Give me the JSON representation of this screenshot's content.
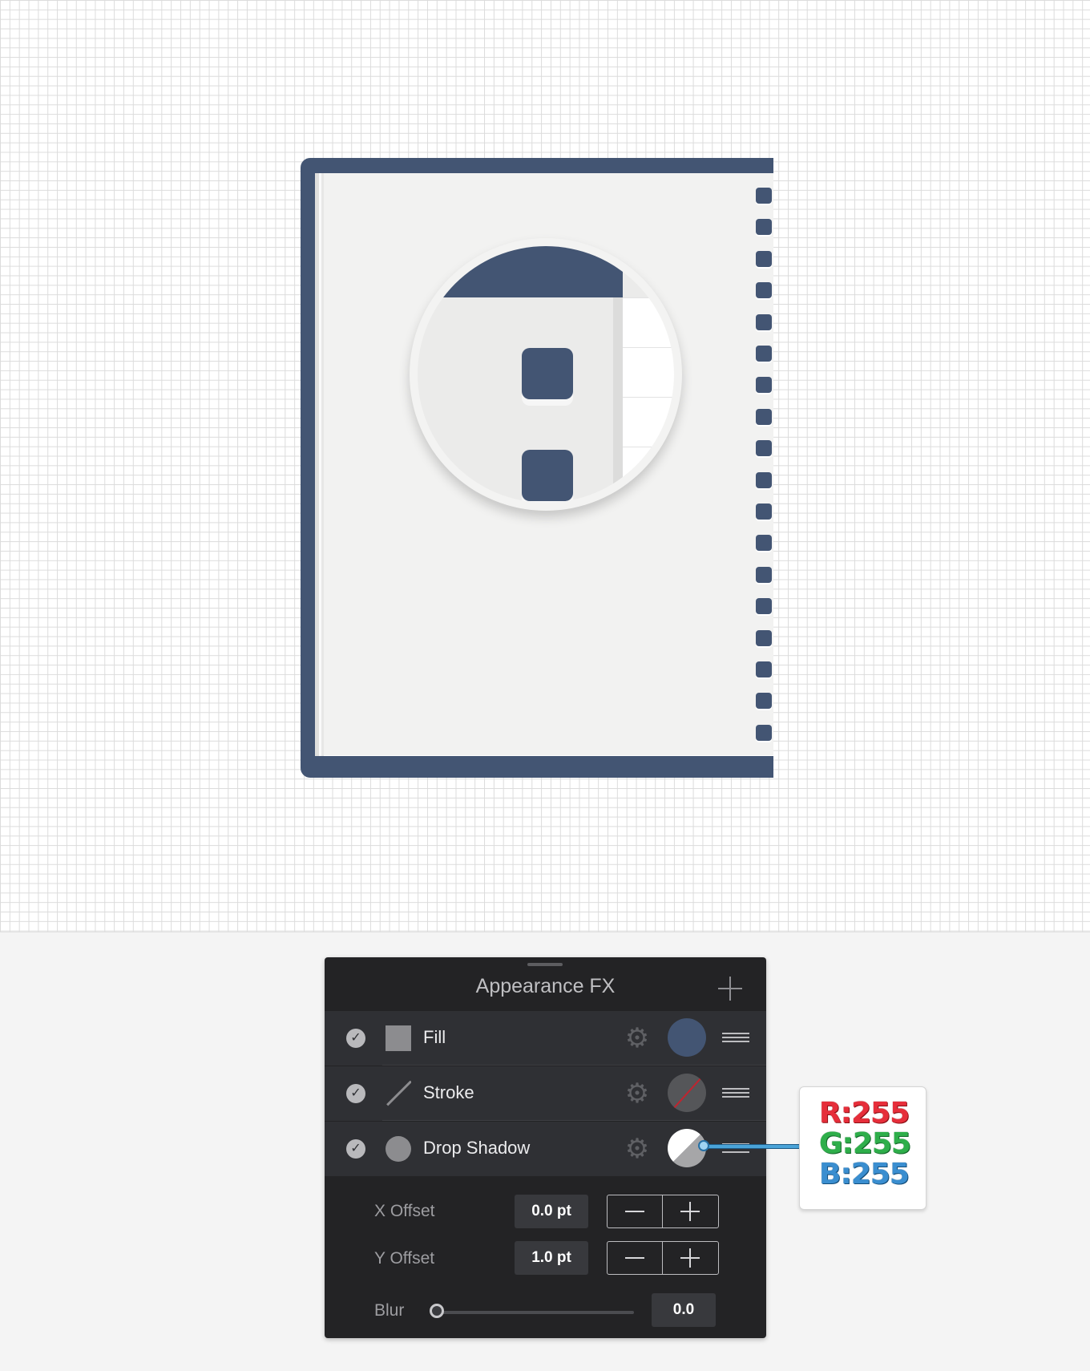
{
  "panel": {
    "title": "Appearance FX",
    "layers": [
      {
        "label": "Fill",
        "enabled": true,
        "type_icon": "fill-square-icon",
        "swatch_color": "#435573"
      },
      {
        "label": "Stroke",
        "enabled": true,
        "type_icon": "stroke-line-icon",
        "swatch": "none"
      },
      {
        "label": "Drop Shadow",
        "enabled": true,
        "type_icon": "shadow-circle-icon",
        "swatch_color": "#ffffff"
      }
    ],
    "properties": {
      "x_offset_label": "X Offset",
      "x_offset_value": "0.0 pt",
      "y_offset_label": "Y Offset",
      "y_offset_value": "1.0 pt",
      "blur_label": "Blur",
      "blur_value": "0.0"
    }
  },
  "callout": {
    "r": "R:255",
    "g": "G:255",
    "b": "B:255"
  },
  "colors": {
    "notebook_cover": "#435573",
    "page": "#f2f2f1",
    "panel_bg": "#232325",
    "row_bg": "#2f3034"
  }
}
